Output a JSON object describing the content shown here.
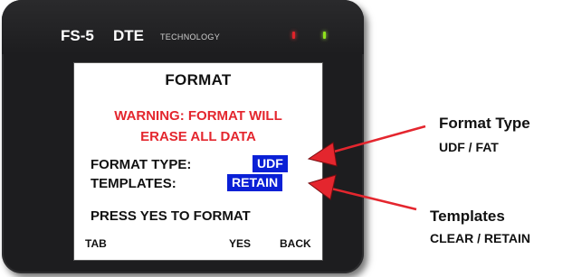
{
  "device": {
    "model": "FS-5",
    "brand": "DTE",
    "brand_sub": "TECHNOLOGY",
    "led_colors": [
      "#e0232a",
      "#8fe21c"
    ]
  },
  "screen": {
    "title": "FORMAT",
    "warning_line1": "WARNING: FORMAT WILL",
    "warning_line2": "ERASE ALL DATA",
    "format_type_label": "FORMAT TYPE:",
    "format_type_value": "UDF",
    "templates_label": "TEMPLATES:",
    "templates_value": "RETAIN",
    "prompt": "PRESS YES TO FORMAT",
    "softkeys": {
      "tab": "TAB",
      "yes": "YES",
      "back": "BACK"
    }
  },
  "annotations": {
    "format_type_title": "Format Type",
    "format_type_options": "UDF / FAT",
    "templates_title": "Templates",
    "templates_options": "CLEAR / RETAIN"
  },
  "colors": {
    "warning": "#e4262e",
    "highlight": "#0a20d6",
    "arrow": "#e4262e"
  }
}
